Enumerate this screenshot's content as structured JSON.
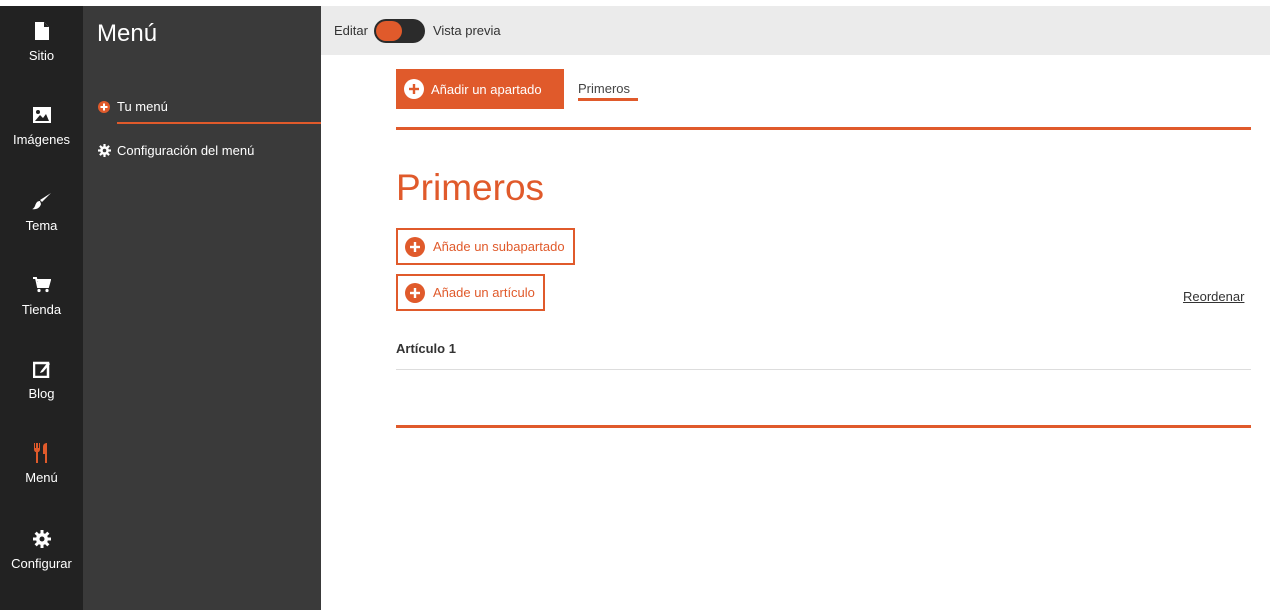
{
  "rail": {
    "items": [
      {
        "label": "Sitio",
        "icon": "file-icon"
      },
      {
        "label": "Imágenes",
        "icon": "image-icon"
      },
      {
        "label": "Tema",
        "icon": "brush-icon"
      },
      {
        "label": "Tienda",
        "icon": "cart-icon"
      },
      {
        "label": "Blog",
        "icon": "edit-icon"
      },
      {
        "label": "Menú",
        "icon": "utensils-icon",
        "active": true
      },
      {
        "label": "Configurar",
        "icon": "gear-icon"
      }
    ]
  },
  "panel": {
    "title": "Menú",
    "items": [
      {
        "label": "Tu menú",
        "icon": "plus-circle-icon",
        "active": true
      },
      {
        "label": "Configuración del menú",
        "icon": "gear-icon"
      }
    ]
  },
  "topbar": {
    "edit_label": "Editar",
    "preview_label": "Vista previa"
  },
  "main": {
    "add_section_label": "Añadir un apartado",
    "tab_label": "Primeros",
    "section_title": "Primeros",
    "add_subsection_label": "Añade un subapartado",
    "add_article_label": "Añade un artículo",
    "reorder_label": "Reordenar",
    "articles": [
      "Artículo 1"
    ]
  },
  "colors": {
    "accent": "#e05a2b",
    "rail_bg": "#222222",
    "panel_bg": "#3a3a3a",
    "topbar_bg": "#ebebeb"
  }
}
